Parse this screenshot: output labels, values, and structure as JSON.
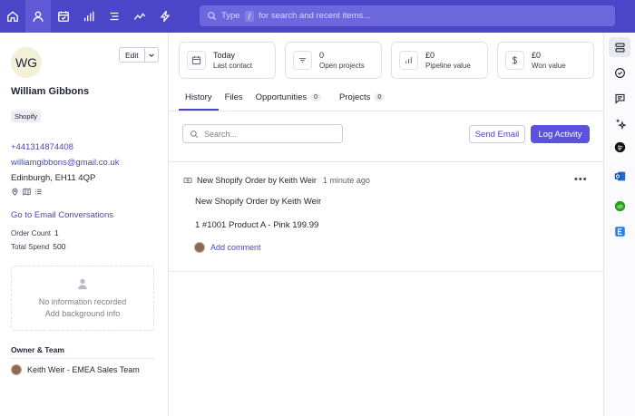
{
  "topbar": {
    "search_prefix": "Type",
    "search_key": "/",
    "search_suffix": "for search and recent items..."
  },
  "contact": {
    "initials": "WG",
    "name": "William Gibbons",
    "edit_label": "Edit",
    "tag": "Shopify",
    "phone": "+441314874408",
    "email": "williamgibbons@gmail.co.uk",
    "address": "Edinburgh, EH11 4QP",
    "email_conversations_link": "Go to Email Conversations",
    "order_count_label": "Order Count",
    "order_count": "1",
    "total_spend_label": "Total Spend",
    "total_spend": "500",
    "no_info_line1": "No information recorded",
    "no_info_line2": "Add background info",
    "owner_team_title": "Owner & Team",
    "owner": "Keith Weir - EMEA Sales Team"
  },
  "summary": [
    {
      "value": "Today",
      "label": "Last contact",
      "icon": "calendar-icon"
    },
    {
      "value": "0",
      "label": "Open projects",
      "icon": "sliders-icon"
    },
    {
      "value": "£0",
      "label": "Pipeline value",
      "icon": "bar-chart-icon"
    },
    {
      "value": "£0",
      "label": "Won value",
      "icon": "dollar-icon"
    }
  ],
  "tabs": [
    {
      "label": "History",
      "count": ""
    },
    {
      "label": "Files",
      "count": ""
    },
    {
      "label": "Opportunities",
      "count": "0"
    },
    {
      "label": "Projects",
      "count": "0"
    }
  ],
  "toolbar": {
    "search_placeholder": "Search...",
    "send_email": "Send Email",
    "log_activity": "Log Activity"
  },
  "activity": {
    "header": "New Shopify Order by Keith Weir",
    "time": "1 minute ago",
    "title": "New Shopify Order by Keith Weir",
    "body": "1 #1001 Product A - Pink 199.99",
    "add_comment": "Add comment"
  },
  "colors": {
    "brand": "#4b45c8",
    "button": "#5b53e0"
  }
}
